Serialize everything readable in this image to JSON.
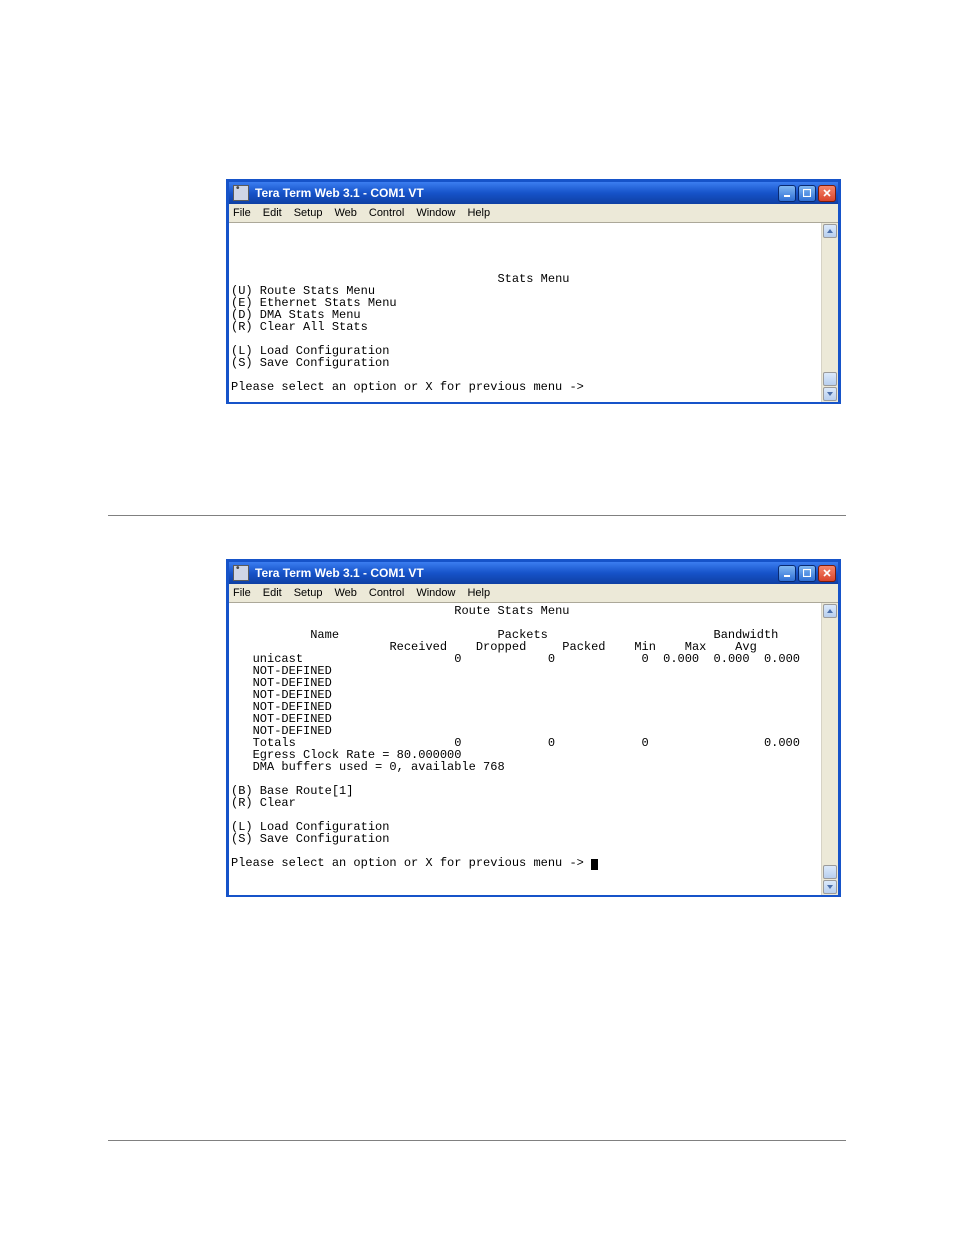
{
  "win1": {
    "title": "Tera Term Web 3.1 - COM1 VT",
    "menu": [
      "File",
      "Edit",
      "Setup",
      "Web",
      "Control",
      "Window",
      "Help"
    ],
    "screen_title": "Stats Menu",
    "opts": [
      "(U) Route Stats Menu",
      "(E) Ethernet Stats Menu",
      "(D) DMA Stats Menu",
      "(R) Clear All Stats"
    ],
    "opts2": [
      "(L) Load Configuration",
      "(S) Save Configuration"
    ],
    "prompt": "Please select an option or X for previous menu ->"
  },
  "win2": {
    "title": "Tera Term Web 3.1 - COM1 VT",
    "menu": [
      "File",
      "Edit",
      "Setup",
      "Web",
      "Control",
      "Window",
      "Help"
    ],
    "screen_title": "Route Stats Menu",
    "header1_name": "Name",
    "header1_packets": "Packets",
    "header1_bw": "Bandwidth",
    "header2": {
      "received": "Received",
      "dropped": "Dropped",
      "packed": "Packed",
      "min": "Min",
      "max": "Max",
      "avg": "Avg"
    },
    "row_unicast": {
      "name": "unicast",
      "received": "0",
      "dropped": "0",
      "packed": "0",
      "min": "0.000",
      "max": "0.000",
      "avg": "0.000"
    },
    "nd": "NOT-DEFINED",
    "totals": {
      "name": "Totals",
      "received": "0",
      "dropped": "0",
      "packed": "0",
      "avg": "0.000"
    },
    "egress": "Egress Clock Rate = 80.000000",
    "dma": "DMA buffers used = 0, available 768",
    "opts": [
      "(B) Base Route[1]",
      "(R) Clear"
    ],
    "opts2": [
      "(L) Load Configuration",
      "(S) Save Configuration"
    ],
    "prompt": "Please select an option or X for previous menu -> "
  }
}
